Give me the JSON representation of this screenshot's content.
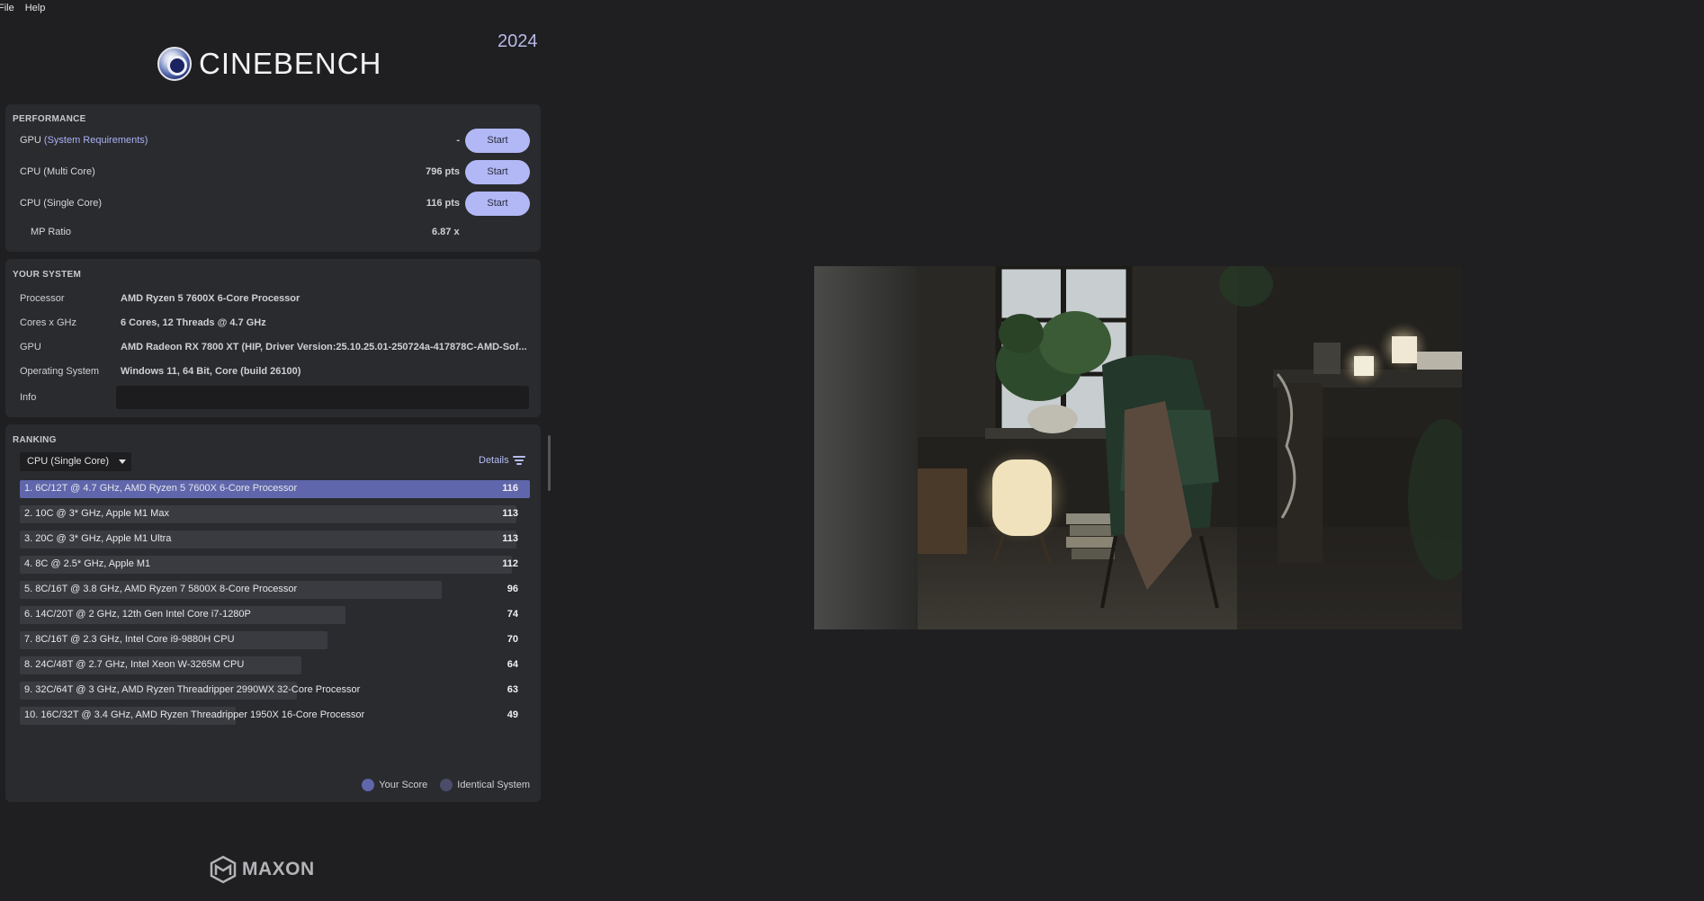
{
  "menu": {
    "file": "File",
    "help": "Help"
  },
  "brand": {
    "name": "CINEBENCH",
    "year": "2024",
    "footer": "MAXON"
  },
  "performance": {
    "title": "PERFORMANCE",
    "gpu": {
      "label": "GPU",
      "link": "(System Requirements)",
      "value": "-",
      "button": "Start"
    },
    "cpu_multi": {
      "label": "CPU (Multi Core)",
      "value": "796 pts",
      "button": "Start"
    },
    "cpu_single": {
      "label": "CPU (Single Core)",
      "value": "116 pts",
      "button": "Start"
    },
    "mp_ratio": {
      "label": "MP Ratio",
      "value": "6.87 x"
    }
  },
  "system": {
    "title": "YOUR SYSTEM",
    "rows": [
      {
        "key": "Processor",
        "value": "AMD Ryzen 5 7600X 6-Core Processor"
      },
      {
        "key": "Cores x GHz",
        "value": "6 Cores, 12 Threads @ 4.7 GHz"
      },
      {
        "key": "GPU",
        "value": "AMD Radeon RX 7800 XT (HIP, Driver Version:25.10.25.01-250724a-417878C-AMD-Sof..."
      },
      {
        "key": "Operating System",
        "value": "Windows 11, 64 Bit, Core (build 26100)"
      },
      {
        "key": "Info",
        "value": ""
      }
    ]
  },
  "ranking": {
    "title": "RANKING",
    "selected_test": "CPU (Single Core)",
    "details": "Details",
    "max_score": 116,
    "items": [
      {
        "name": "1. 6C/12T @ 4.7 GHz, AMD Ryzen 5 7600X 6-Core Processor",
        "score": 116,
        "is_me": true
      },
      {
        "name": "2. 10C @ 3* GHz, Apple M1 Max",
        "score": 113,
        "is_me": false
      },
      {
        "name": "3. 20C @ 3* GHz, Apple M1 Ultra",
        "score": 113,
        "is_me": false
      },
      {
        "name": "4. 8C @ 2.5* GHz, Apple M1",
        "score": 112,
        "is_me": false
      },
      {
        "name": "5. 8C/16T @ 3.8 GHz, AMD Ryzen 7 5800X 8-Core Processor",
        "score": 96,
        "is_me": false
      },
      {
        "name": "6. 14C/20T @ 2 GHz, 12th Gen Intel Core i7-1280P",
        "score": 74,
        "is_me": false
      },
      {
        "name": "7. 8C/16T @ 2.3 GHz, Intel Core i9-9880H CPU",
        "score": 70,
        "is_me": false
      },
      {
        "name": "8. 24C/48T @ 2.7 GHz, Intel Xeon W-3265M CPU",
        "score": 64,
        "is_me": false
      },
      {
        "name": "9. 32C/64T @ 3 GHz, AMD Ryzen Threadripper 2990WX 32-Core Processor",
        "score": 63,
        "is_me": false
      },
      {
        "name": "10. 16C/32T @ 3.4 GHz, AMD Ryzen Threadripper 1950X 16-Core Processor",
        "score": 49,
        "is_me": false
      }
    ],
    "legend": {
      "your_score": "Your Score",
      "identical": "Identical System"
    }
  },
  "colors": {
    "accent": "#b2b8f6",
    "your_score": "#5f66ab",
    "identical": "#4a4c6a",
    "panel": "#2a2b2f",
    "background": "#1f1f21"
  },
  "icons": [
    "cinebench-logo-icon",
    "caret-down-icon",
    "filter-icon",
    "maxon-logo-icon"
  ]
}
